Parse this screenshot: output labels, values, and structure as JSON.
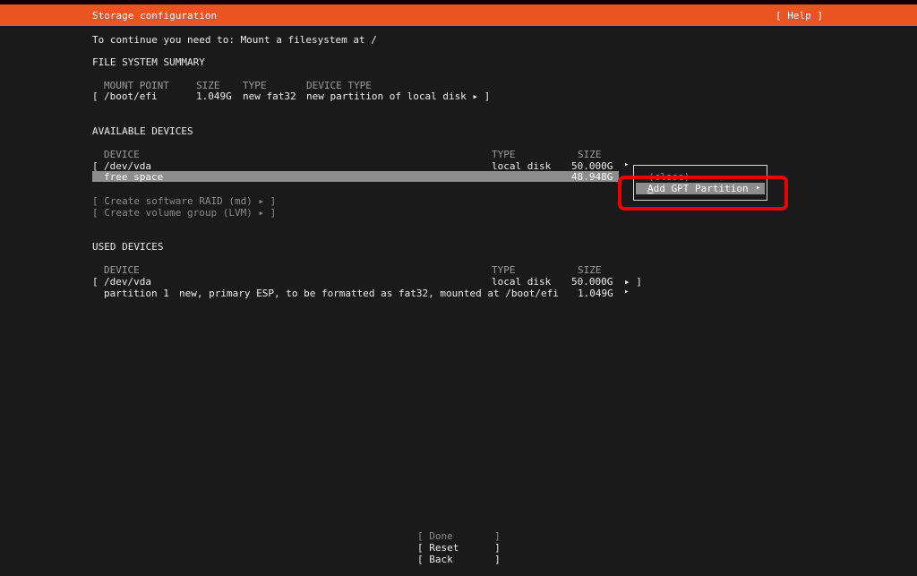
{
  "header": {
    "title": "Storage configuration",
    "help": "[ Help ]"
  },
  "message": "To continue you need to: Mount a filesystem at /",
  "fs_summary": {
    "heading": "FILE SYSTEM SUMMARY",
    "columns": {
      "mount": "MOUNT POINT",
      "size": "SIZE",
      "type": "TYPE",
      "device_type": "DEVICE TYPE"
    },
    "rows": [
      {
        "bracket": "[",
        "mount": "/boot/efi",
        "size": "1.049G",
        "type": "new fat32",
        "device_type": "new partition of local disk ▸ ]"
      }
    ]
  },
  "available": {
    "heading": "AVAILABLE DEVICES",
    "columns": {
      "device": "DEVICE",
      "type": "TYPE",
      "size": "SIZE"
    },
    "disk": {
      "bracket": "[",
      "device": "/dev/vda",
      "type": "local disk",
      "size": "50.000G",
      "arrow": "▸"
    },
    "free": {
      "label": "free space",
      "size": "48.948G",
      "arrow": "▸"
    },
    "actions": [
      "[ Create software RAID (md) ▸ ]",
      "[ Create volume group (LVM) ▸ ]"
    ]
  },
  "popup": {
    "close_label": "(close)",
    "items": [
      {
        "hotkey": "A",
        "rest": "dd GPT Partition",
        "arrow": "▸"
      }
    ]
  },
  "used": {
    "heading": "USED DEVICES",
    "columns": {
      "device": "DEVICE",
      "type": "TYPE",
      "size": "SIZE"
    },
    "disk": {
      "bracket": "[",
      "device": "/dev/vda",
      "type": "local disk",
      "size": "50.000G",
      "arrow": "▸ ]"
    },
    "partition": {
      "label": "partition 1",
      "description": "new, primary ESP, to be formatted as fat32, mounted at /boot/efi",
      "size": "1.049G",
      "arrow": "▸"
    }
  },
  "buttons": {
    "done": "[ Done       ]",
    "reset": "[ Reset      ]",
    "back": "[ Back       ]"
  },
  "colors": {
    "header": "#e95420",
    "background": "#1a1a1a",
    "highlight": "#8d8d8d",
    "annotation": "#ee0000"
  }
}
